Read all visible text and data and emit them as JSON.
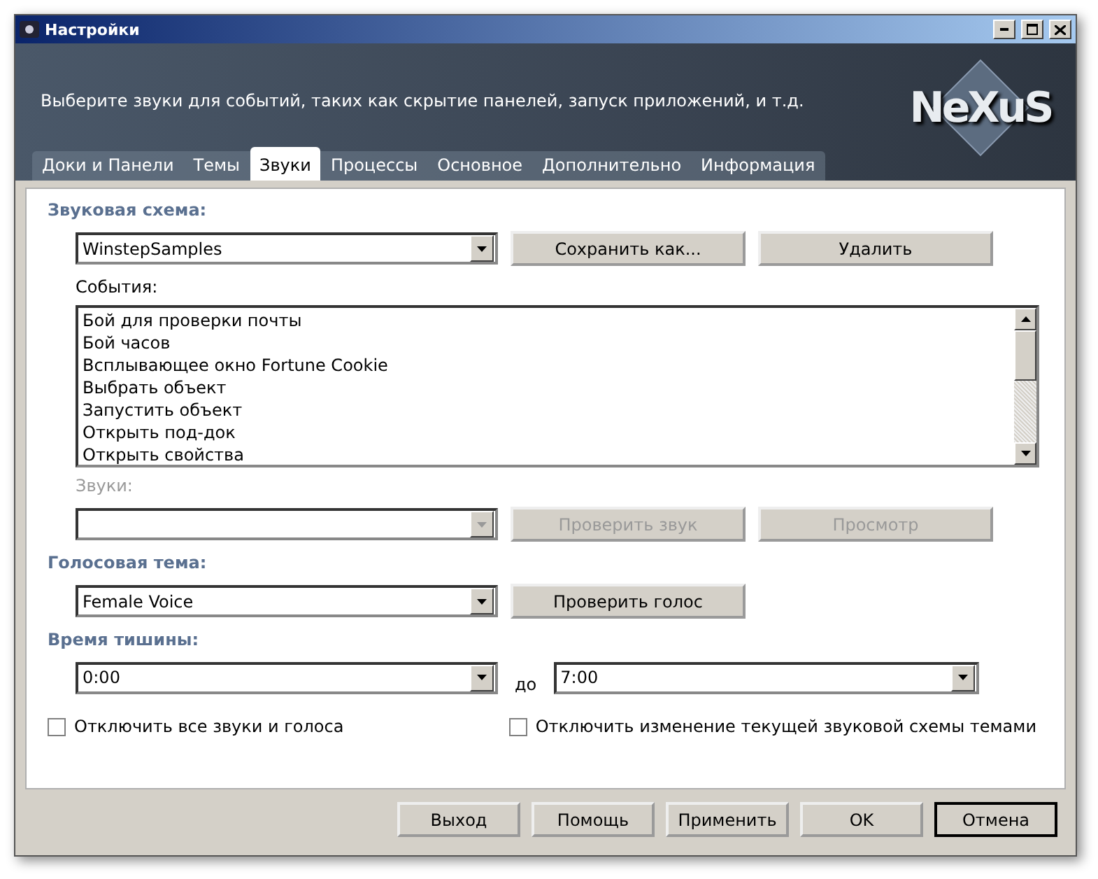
{
  "window": {
    "title": "Настройки"
  },
  "header": {
    "description": "Выберите звуки для событий, таких как скрытие панелей, запуск приложений, и т.д.",
    "logo": "NeXuS"
  },
  "tabs": [
    {
      "label": "Доки и Панели",
      "selected": false
    },
    {
      "label": "Темы",
      "selected": false
    },
    {
      "label": "Звуки",
      "selected": true
    },
    {
      "label": "Процессы",
      "selected": false
    },
    {
      "label": "Основное",
      "selected": false
    },
    {
      "label": "Дополнительно",
      "selected": false
    },
    {
      "label": "Информация",
      "selected": false
    }
  ],
  "sound_scheme": {
    "heading": "Звуковая схема:",
    "value": "WinstepSamples",
    "buttons": [
      {
        "label": "Сохранить как...",
        "disabled": false
      },
      {
        "label": "Удалить",
        "disabled": false
      }
    ]
  },
  "events": {
    "label": "События:",
    "items": [
      "Бой для проверки почты",
      "Бой часов",
      "Всплывающее окно Fortune Cookie",
      "Выбрать объект",
      "Запустить объект",
      "Открыть под-док",
      "Открыть свойства"
    ]
  },
  "sounds": {
    "label": "Звуки:",
    "disabled": true,
    "buttons": [
      {
        "label": "Проверить звук",
        "disabled": true
      },
      {
        "label": "Просмотр",
        "disabled": true
      }
    ]
  },
  "voice_theme": {
    "heading": "Голосовая тема:",
    "value": "Female Voice",
    "buttons": [
      {
        "label": "Проверить голос",
        "disabled": false
      }
    ]
  },
  "quiet_time": {
    "heading": "Время тишины:",
    "from": "0:00",
    "separator": "до",
    "to": "7:00"
  },
  "checkboxes": [
    {
      "label": "Отключить все звуки и голоса",
      "checked": false
    },
    {
      "label": "Отключить изменение текущей звуковой схемы темами",
      "checked": false
    }
  ],
  "footer_buttons": [
    {
      "label": "Выход",
      "default": false
    },
    {
      "label": "Помощь",
      "default": false
    },
    {
      "label": "Применить",
      "default": false
    },
    {
      "label": "OK",
      "default": false
    },
    {
      "label": "Отмена",
      "default": true
    }
  ]
}
